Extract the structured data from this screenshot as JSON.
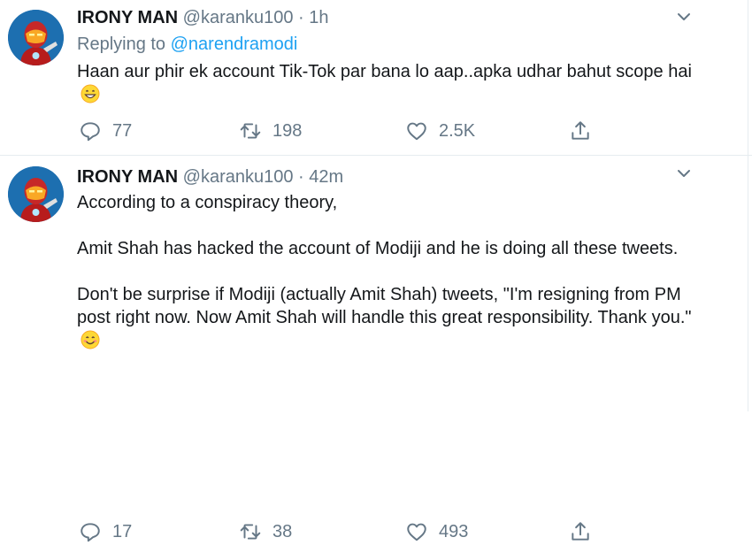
{
  "tweets": [
    {
      "author_name": "IRONY MAN",
      "handle": "@karanku100",
      "separator": "·",
      "time": "1h",
      "replying_prefix": "Replying to ",
      "replying_to": "@narendramodi",
      "text_lines": [
        "Haan aur phir ek account Tik-Tok par bana lo aap..apka udhar bahut scope hai"
      ],
      "emoji": "grinning-face-emoji",
      "replies": "77",
      "retweets": "198",
      "likes": "2.5K"
    },
    {
      "author_name": "IRONY MAN",
      "handle": "@karanku100",
      "separator": "·",
      "time": "42m",
      "text_lines": [
        "According to a conspiracy theory,",
        "Amit Shah has hacked the account of Modiji and he is doing all these tweets.",
        "Don't be surprise if Modiji (actually Amit Shah) tweets, \"I'm resigning from PM post right now. Now Amit Shah will handle this great responsibility. Thank you.\""
      ],
      "emoji": "smiling-face-emoji",
      "replies": "17",
      "retweets": "38",
      "likes": "493"
    }
  ],
  "colors": {
    "text": "#14171a",
    "secondary": "#657786",
    "link": "#1da1f2",
    "divider": "#e6ecf0"
  },
  "icons": [
    "chevron-down-icon",
    "reply-icon",
    "retweet-icon",
    "like-icon",
    "share-icon"
  ]
}
